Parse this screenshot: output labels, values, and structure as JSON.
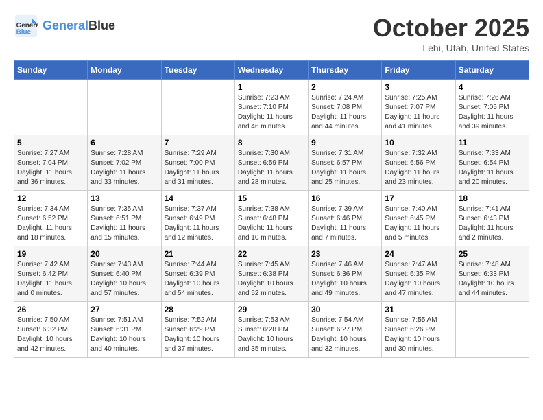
{
  "header": {
    "logo_line1": "General",
    "logo_line2": "Blue",
    "month_title": "October 2025",
    "location": "Lehi, Utah, United States"
  },
  "days_of_week": [
    "Sunday",
    "Monday",
    "Tuesday",
    "Wednesday",
    "Thursday",
    "Friday",
    "Saturday"
  ],
  "weeks": [
    [
      {
        "day": "",
        "info": ""
      },
      {
        "day": "",
        "info": ""
      },
      {
        "day": "",
        "info": ""
      },
      {
        "day": "1",
        "info": "Sunrise: 7:23 AM\nSunset: 7:10 PM\nDaylight: 11 hours and 46 minutes."
      },
      {
        "day": "2",
        "info": "Sunrise: 7:24 AM\nSunset: 7:08 PM\nDaylight: 11 hours and 44 minutes."
      },
      {
        "day": "3",
        "info": "Sunrise: 7:25 AM\nSunset: 7:07 PM\nDaylight: 11 hours and 41 minutes."
      },
      {
        "day": "4",
        "info": "Sunrise: 7:26 AM\nSunset: 7:05 PM\nDaylight: 11 hours and 39 minutes."
      }
    ],
    [
      {
        "day": "5",
        "info": "Sunrise: 7:27 AM\nSunset: 7:04 PM\nDaylight: 11 hours and 36 minutes."
      },
      {
        "day": "6",
        "info": "Sunrise: 7:28 AM\nSunset: 7:02 PM\nDaylight: 11 hours and 33 minutes."
      },
      {
        "day": "7",
        "info": "Sunrise: 7:29 AM\nSunset: 7:00 PM\nDaylight: 11 hours and 31 minutes."
      },
      {
        "day": "8",
        "info": "Sunrise: 7:30 AM\nSunset: 6:59 PM\nDaylight: 11 hours and 28 minutes."
      },
      {
        "day": "9",
        "info": "Sunrise: 7:31 AM\nSunset: 6:57 PM\nDaylight: 11 hours and 25 minutes."
      },
      {
        "day": "10",
        "info": "Sunrise: 7:32 AM\nSunset: 6:56 PM\nDaylight: 11 hours and 23 minutes."
      },
      {
        "day": "11",
        "info": "Sunrise: 7:33 AM\nSunset: 6:54 PM\nDaylight: 11 hours and 20 minutes."
      }
    ],
    [
      {
        "day": "12",
        "info": "Sunrise: 7:34 AM\nSunset: 6:52 PM\nDaylight: 11 hours and 18 minutes."
      },
      {
        "day": "13",
        "info": "Sunrise: 7:35 AM\nSunset: 6:51 PM\nDaylight: 11 hours and 15 minutes."
      },
      {
        "day": "14",
        "info": "Sunrise: 7:37 AM\nSunset: 6:49 PM\nDaylight: 11 hours and 12 minutes."
      },
      {
        "day": "15",
        "info": "Sunrise: 7:38 AM\nSunset: 6:48 PM\nDaylight: 11 hours and 10 minutes."
      },
      {
        "day": "16",
        "info": "Sunrise: 7:39 AM\nSunset: 6:46 PM\nDaylight: 11 hours and 7 minutes."
      },
      {
        "day": "17",
        "info": "Sunrise: 7:40 AM\nSunset: 6:45 PM\nDaylight: 11 hours and 5 minutes."
      },
      {
        "day": "18",
        "info": "Sunrise: 7:41 AM\nSunset: 6:43 PM\nDaylight: 11 hours and 2 minutes."
      }
    ],
    [
      {
        "day": "19",
        "info": "Sunrise: 7:42 AM\nSunset: 6:42 PM\nDaylight: 11 hours and 0 minutes."
      },
      {
        "day": "20",
        "info": "Sunrise: 7:43 AM\nSunset: 6:40 PM\nDaylight: 10 hours and 57 minutes."
      },
      {
        "day": "21",
        "info": "Sunrise: 7:44 AM\nSunset: 6:39 PM\nDaylight: 10 hours and 54 minutes."
      },
      {
        "day": "22",
        "info": "Sunrise: 7:45 AM\nSunset: 6:38 PM\nDaylight: 10 hours and 52 minutes."
      },
      {
        "day": "23",
        "info": "Sunrise: 7:46 AM\nSunset: 6:36 PM\nDaylight: 10 hours and 49 minutes."
      },
      {
        "day": "24",
        "info": "Sunrise: 7:47 AM\nSunset: 6:35 PM\nDaylight: 10 hours and 47 minutes."
      },
      {
        "day": "25",
        "info": "Sunrise: 7:48 AM\nSunset: 6:33 PM\nDaylight: 10 hours and 44 minutes."
      }
    ],
    [
      {
        "day": "26",
        "info": "Sunrise: 7:50 AM\nSunset: 6:32 PM\nDaylight: 10 hours and 42 minutes."
      },
      {
        "day": "27",
        "info": "Sunrise: 7:51 AM\nSunset: 6:31 PM\nDaylight: 10 hours and 40 minutes."
      },
      {
        "day": "28",
        "info": "Sunrise: 7:52 AM\nSunset: 6:29 PM\nDaylight: 10 hours and 37 minutes."
      },
      {
        "day": "29",
        "info": "Sunrise: 7:53 AM\nSunset: 6:28 PM\nDaylight: 10 hours and 35 minutes."
      },
      {
        "day": "30",
        "info": "Sunrise: 7:54 AM\nSunset: 6:27 PM\nDaylight: 10 hours and 32 minutes."
      },
      {
        "day": "31",
        "info": "Sunrise: 7:55 AM\nSunset: 6:26 PM\nDaylight: 10 hours and 30 minutes."
      },
      {
        "day": "",
        "info": ""
      }
    ]
  ]
}
